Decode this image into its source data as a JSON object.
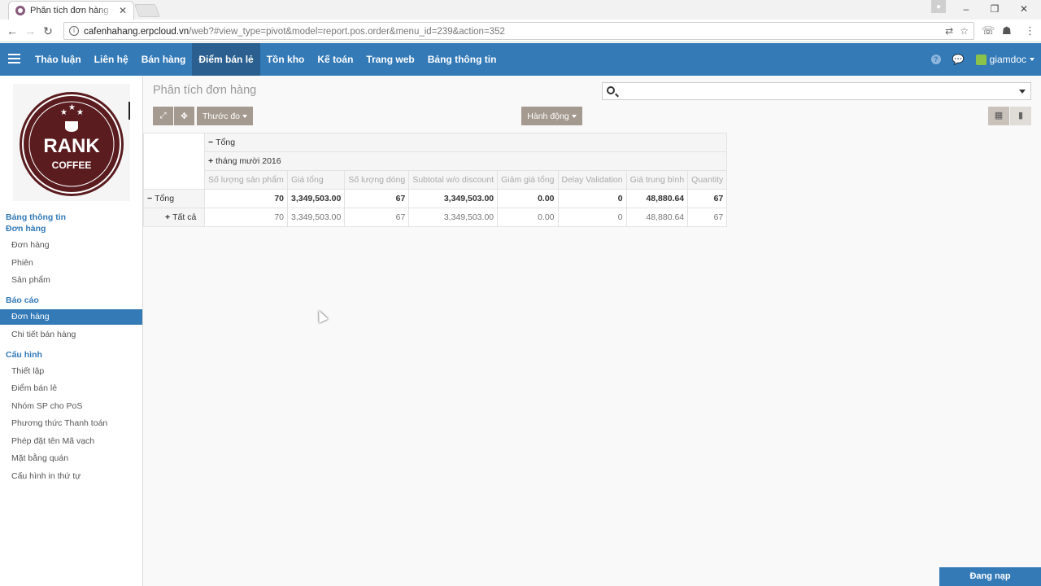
{
  "browser": {
    "tab_title": "Phân tích đơn hàng - Erp",
    "url_host": "cafenhahang.erpcloud.vn",
    "url_rest": "/web?#view_type=pivot&model=report.pos.order&menu_id=239&action=352"
  },
  "navbar": {
    "items": [
      "Thảo luận",
      "Liên hệ",
      "Bán hàng",
      "Điểm bán lẻ",
      "Tồn kho",
      "Kế toán",
      "Trang web",
      "Bảng thông tin"
    ],
    "active": "Điểm bán lẻ",
    "user": "giamdoc"
  },
  "logo": {
    "text_main": "RANK",
    "text_sub": "COFFEE"
  },
  "sidebar": {
    "sections": [
      {
        "title": "Bảng thông tin",
        "items": []
      },
      {
        "title": "Đơn hàng",
        "items": [
          "Đơn hàng",
          "Phiên",
          "Sản phẩm"
        ]
      },
      {
        "title": "Báo cáo",
        "items": [
          "Đơn hàng",
          "Chi tiết bán hàng"
        ]
      },
      {
        "title": "Cấu hình",
        "items": [
          "Thiết lập",
          "Điểm bán lẻ",
          "Nhóm SP cho PoS",
          "Phương thức Thanh toán",
          "Phép đặt tên Mã vạch",
          "Mặt bằng quán",
          "Cấu hình in thứ tự"
        ]
      }
    ],
    "active_item": "Đơn hàng (Báo cáo)"
  },
  "main": {
    "title": "Phân tích đơn hàng",
    "search_placeholder": "",
    "btn_measures": "Thước đo",
    "btn_actions": "Hành động"
  },
  "pivot": {
    "col_header_total": "Tổng",
    "col_header_group": "tháng mười 2016",
    "measures": [
      "Số lượng sản phẩm",
      "Giá tổng",
      "Số lượng dòng",
      "Subtotal w/o discount",
      "Giảm giá tổng",
      "Delay Validation",
      "Giá trung bình",
      "Quantity"
    ],
    "rows": [
      {
        "label": "Tổng",
        "values": [
          "70",
          "3,349,503.00",
          "67",
          "3,349,503.00",
          "0.00",
          "0",
          "48,880.64",
          "67"
        ]
      },
      {
        "label": "Tất cả",
        "values": [
          "70",
          "3,349,503.00",
          "67",
          "3,349,503.00",
          "0.00",
          "0",
          "48,880.64",
          "67"
        ]
      }
    ]
  },
  "footer": {
    "login_label": "Đang nạp"
  }
}
